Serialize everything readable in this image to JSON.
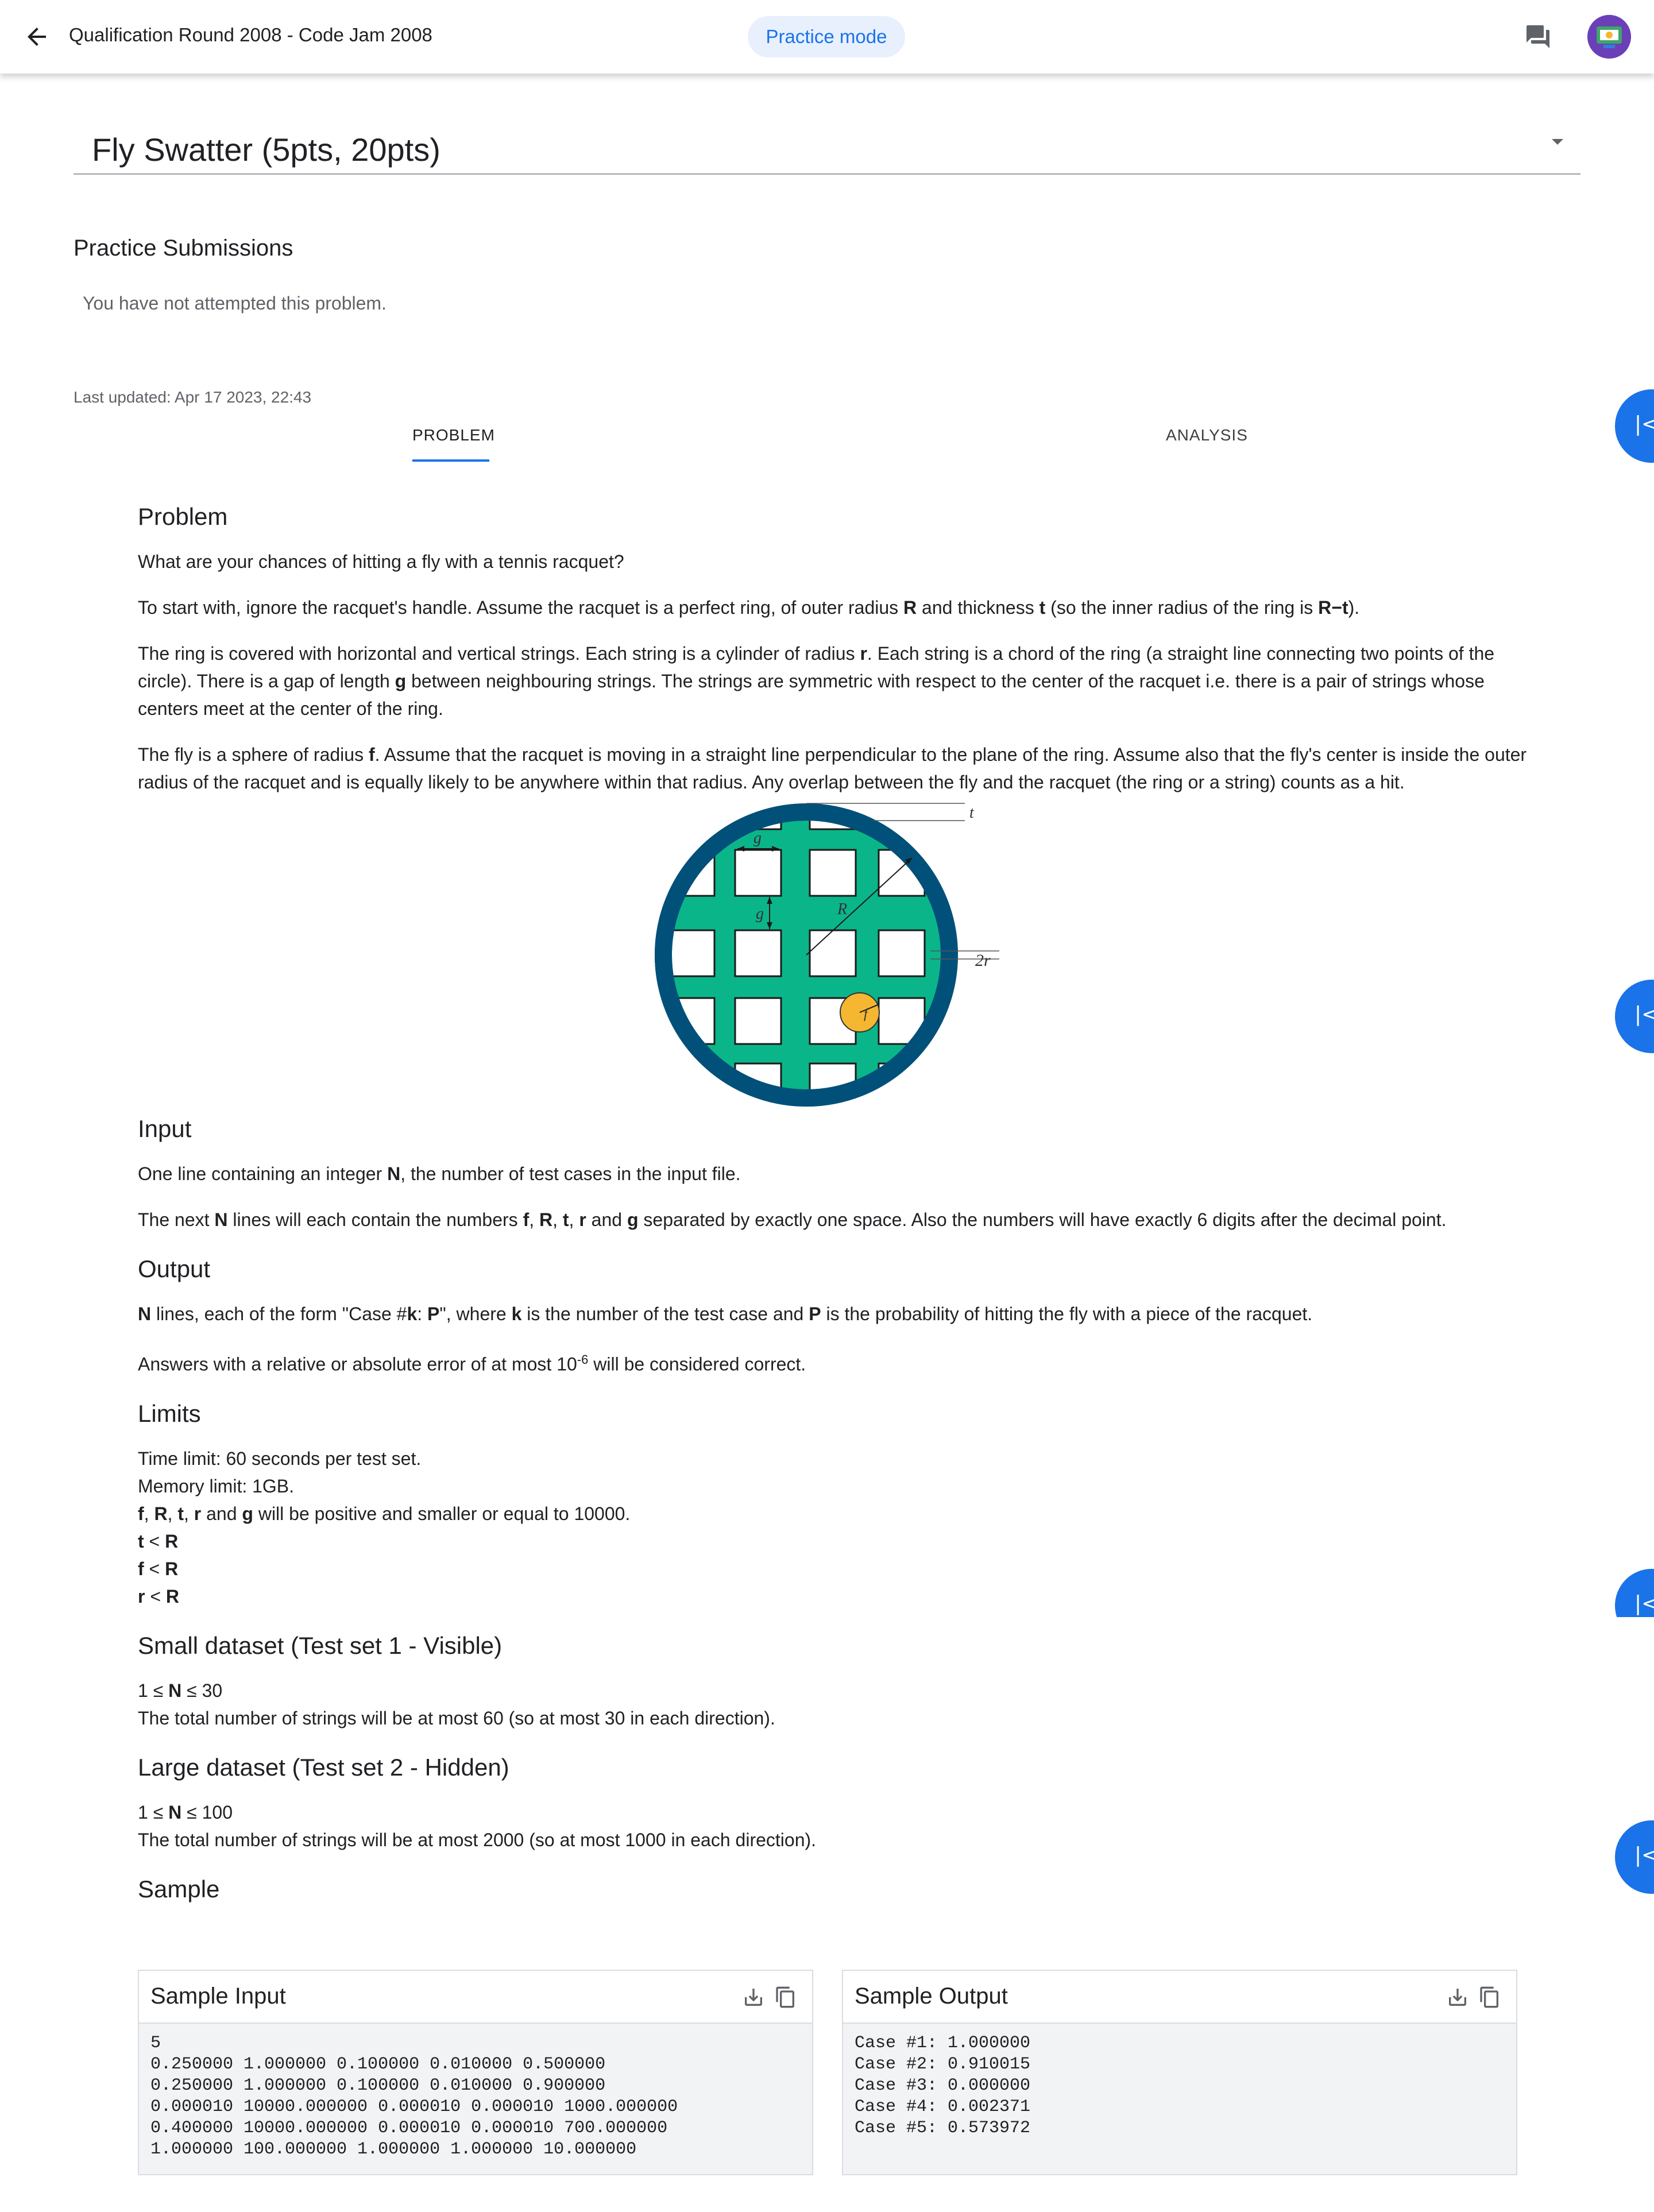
{
  "header": {
    "title": "Qualification Round 2008 - Code Jam 2008",
    "mode_label": "Practice mode",
    "accent": "#1a73e8"
  },
  "problem_select": {
    "value": "Fly Swatter (5pts, 20pts)"
  },
  "submissions": {
    "heading": "Practice Submissions",
    "empty_text": "You have not attempted this problem."
  },
  "last_updated": "Last updated: Apr 17 2023, 22:43",
  "tabs": {
    "problem": "PROBLEM",
    "analysis": "ANALYSIS"
  },
  "content": {
    "problem_heading": "Problem",
    "intro": "What are your chances of hitting a fly with a tennis racquet?",
    "p2": {
      "a": "To start with, ignore the racquet's handle. Assume the racquet is a perfect ring, of outer radius ",
      "b": "R",
      "c": " and thickness ",
      "d": "t",
      "e": " (so the inner radius of the ring is ",
      "f": "R−t",
      "g": ")."
    },
    "p3": {
      "a": "The ring is covered with horizontal and vertical strings. Each string is a cylinder of radius ",
      "b": "r",
      "c": ". Each string is a chord of the ring (a straight line connecting two points of the circle). There is a gap of length ",
      "d": "g",
      "e": " between neighbouring strings. The strings are symmetric with respect to the center of the racquet i.e. there is a pair of strings whose centers meet at the center of the ring."
    },
    "p4": {
      "a": "The fly is a sphere of radius ",
      "b": "f",
      "c": ". Assume that the racquet is moving in a straight line perpendicular to the plane of the ring. Assume also that the fly's center is inside the outer radius of the racquet and is equally likely to be anywhere within that radius. Any overlap between the fly and the racquet (the ring or a string) counts as a hit."
    },
    "figure_labels": {
      "g": "g",
      "g2": "g",
      "R": "R",
      "t": "t",
      "r2": "2r",
      "f": "f"
    },
    "figure_colors": {
      "ring": "#00507a",
      "strings": "#0bb58a",
      "fly": "#f5b731"
    },
    "input_heading": "Input",
    "input_p1": {
      "a": "One line containing an integer ",
      "b": "N",
      "c": ", the number of test cases in the input file."
    },
    "input_p2": {
      "a": "The next ",
      "b": "N",
      "c": " lines will each contain the numbers ",
      "d": "f",
      "e": ", ",
      "f": "R",
      "g": ", ",
      "h": "t",
      "i": ", ",
      "j": "r",
      "k": " and ",
      "l": "g",
      "m": " separated by exactly one space. Also the numbers will have exactly 6 digits after the decimal point."
    },
    "output_heading": "Output",
    "output_p1": {
      "a": "N",
      "b": " lines, each of the form \"Case #",
      "c": "k",
      "d": ": ",
      "e": "P",
      "f": "\", where ",
      "g": "k",
      "h": " is the number of the test case and ",
      "i": "P",
      "j": " is the probability of hitting the fly with a piece of the racquet."
    },
    "output_p2": {
      "a": "Answers with a relative or absolute error of at most 10",
      "sup": "-6",
      "b": " will be considered correct."
    },
    "limits_heading": "Limits",
    "limits": {
      "time": "Time limit: 60 seconds per test set.",
      "memory": "Memory limit: 1GB.",
      "l3": {
        "a": "f",
        "b": ", ",
        "c": "R",
        "d": ", ",
        "e": "t",
        "f": ", ",
        "g": "r",
        "h": " and ",
        "i": "g",
        "j": " will be positive and smaller or equal to 10000."
      },
      "l4": {
        "a": "t",
        "b": " < ",
        "c": "R"
      },
      "l5": {
        "a": "f",
        "b": " < ",
        "c": "R"
      },
      "l6": {
        "a": "r",
        "b": " < ",
        "c": "R"
      }
    },
    "small_heading": "Small dataset (Test set 1 - Visible)",
    "small": {
      "a": "1 ≤ ",
      "b": "N",
      "c": " ≤ 30",
      "text": "The total number of strings will be at most 60 (so at most 30 in each direction)."
    },
    "large_heading": "Large dataset (Test set 2 - Hidden)",
    "large": {
      "a": "1 ≤ ",
      "b": "N",
      "c": " ≤ 100",
      "text": "The total number of strings will be at most 2000 (so at most 1000 in each direction)."
    },
    "sample_heading": "Sample"
  },
  "sample": {
    "input_title": "Sample Input",
    "output_title": "Sample Output",
    "input_text": "5\n0.250000 1.000000 0.100000 0.010000 0.500000\n0.250000 1.000000 0.100000 0.010000 0.900000\n0.000010 10000.000000 0.000010 0.000010 1000.000000\n0.400000 10000.000000 0.000010 0.000010 700.000000\n1.000000 100.000000 1.000000 1.000000 10.000000",
    "output_text": "Case #1: 1.000000\nCase #2: 0.910015\nCase #3: 0.000000\nCase #4: 0.002371\nCase #5: 0.573972"
  },
  "side_buttons": {
    "label": "|<"
  }
}
